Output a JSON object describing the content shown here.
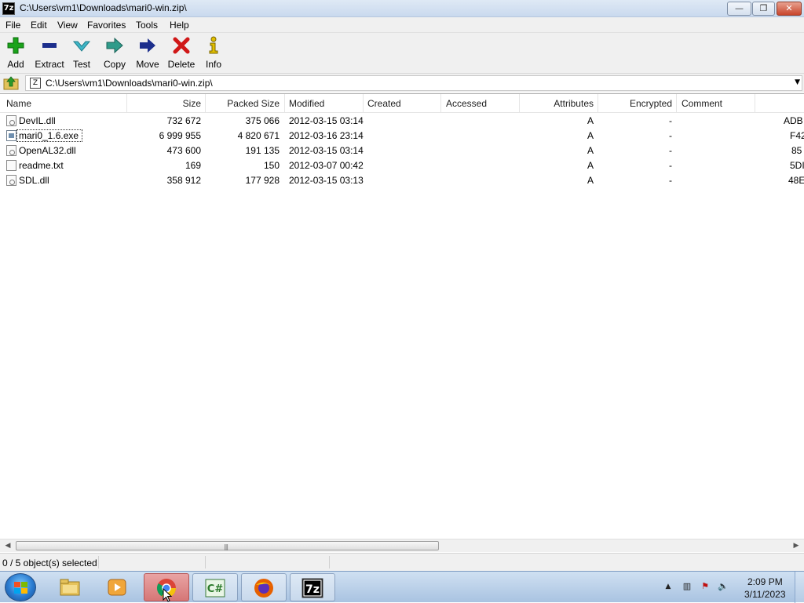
{
  "window": {
    "title": "C:\\Users\\vm1\\Downloads\\mari0-win.zip\\",
    "app_icon": "7z",
    "buttons": {
      "minimize": "—",
      "maximize": "❐",
      "close": "✕"
    }
  },
  "menu": [
    "File",
    "Edit",
    "View",
    "Favorites",
    "Tools",
    "Help"
  ],
  "toolbar": [
    {
      "label": "Add",
      "icon": "add-icon",
      "color": "#1aa31a"
    },
    {
      "label": "Extract",
      "icon": "extract-icon",
      "color": "#1c2e8c"
    },
    {
      "label": "Test",
      "icon": "test-icon",
      "color": "#3fb6c7"
    },
    {
      "label": "Copy",
      "icon": "copy-icon",
      "color": "#2f9b8a"
    },
    {
      "label": "Move",
      "icon": "move-icon",
      "color": "#1c2e8c"
    },
    {
      "label": "Delete",
      "icon": "delete-icon",
      "color": "#d01818"
    },
    {
      "label": "Info",
      "icon": "info-icon",
      "color": "#c9a600"
    }
  ],
  "address": {
    "path": "C:\\Users\\vm1\\Downloads\\mari0-win.zip\\"
  },
  "columns": [
    "Name",
    "Size",
    "Packed Size",
    "Modified",
    "Created",
    "Accessed",
    "Attributes",
    "Encrypted",
    "Comment"
  ],
  "files": [
    {
      "name": "DevIL.dll",
      "size": "732 672",
      "packed": "375 066",
      "modified": "2012-03-15 03:14",
      "attributes": "A",
      "encrypted": "-",
      "crc": "ADB",
      "type": "dll"
    },
    {
      "name": "mari0_1.6.exe",
      "size": "6 999 955",
      "packed": "4 820 671",
      "modified": "2012-03-16 23:14",
      "attributes": "A",
      "encrypted": "-",
      "crc": "F42",
      "type": "exe"
    },
    {
      "name": "OpenAL32.dll",
      "size": "473 600",
      "packed": "191 135",
      "modified": "2012-03-15 03:14",
      "attributes": "A",
      "encrypted": "-",
      "crc": "85",
      "type": "dll"
    },
    {
      "name": "readme.txt",
      "size": "169",
      "packed": "150",
      "modified": "2012-03-07 00:42",
      "attributes": "A",
      "encrypted": "-",
      "crc": "5DI",
      "type": "txt"
    },
    {
      "name": "SDL.dll",
      "size": "358 912",
      "packed": "177 928",
      "modified": "2012-03-15 03:13",
      "attributes": "A",
      "encrypted": "-",
      "crc": "48E",
      "type": "dll"
    }
  ],
  "status": {
    "selection": "0 / 5 object(s) selected"
  },
  "taskbar": {
    "apps": [
      {
        "name": "file-explorer",
        "icon": "folder-icon"
      },
      {
        "name": "media-player",
        "icon": "media-player-icon"
      },
      {
        "name": "chrome",
        "icon": "chrome-icon",
        "active": true
      },
      {
        "name": "csharp",
        "icon": "csharp-icon",
        "label": "C#"
      },
      {
        "name": "firefox",
        "icon": "firefox-icon"
      },
      {
        "name": "7zip",
        "icon": "7zip-icon",
        "label": "7z"
      }
    ],
    "clock": {
      "time": "2:09 PM",
      "date": "3/11/2023"
    }
  }
}
